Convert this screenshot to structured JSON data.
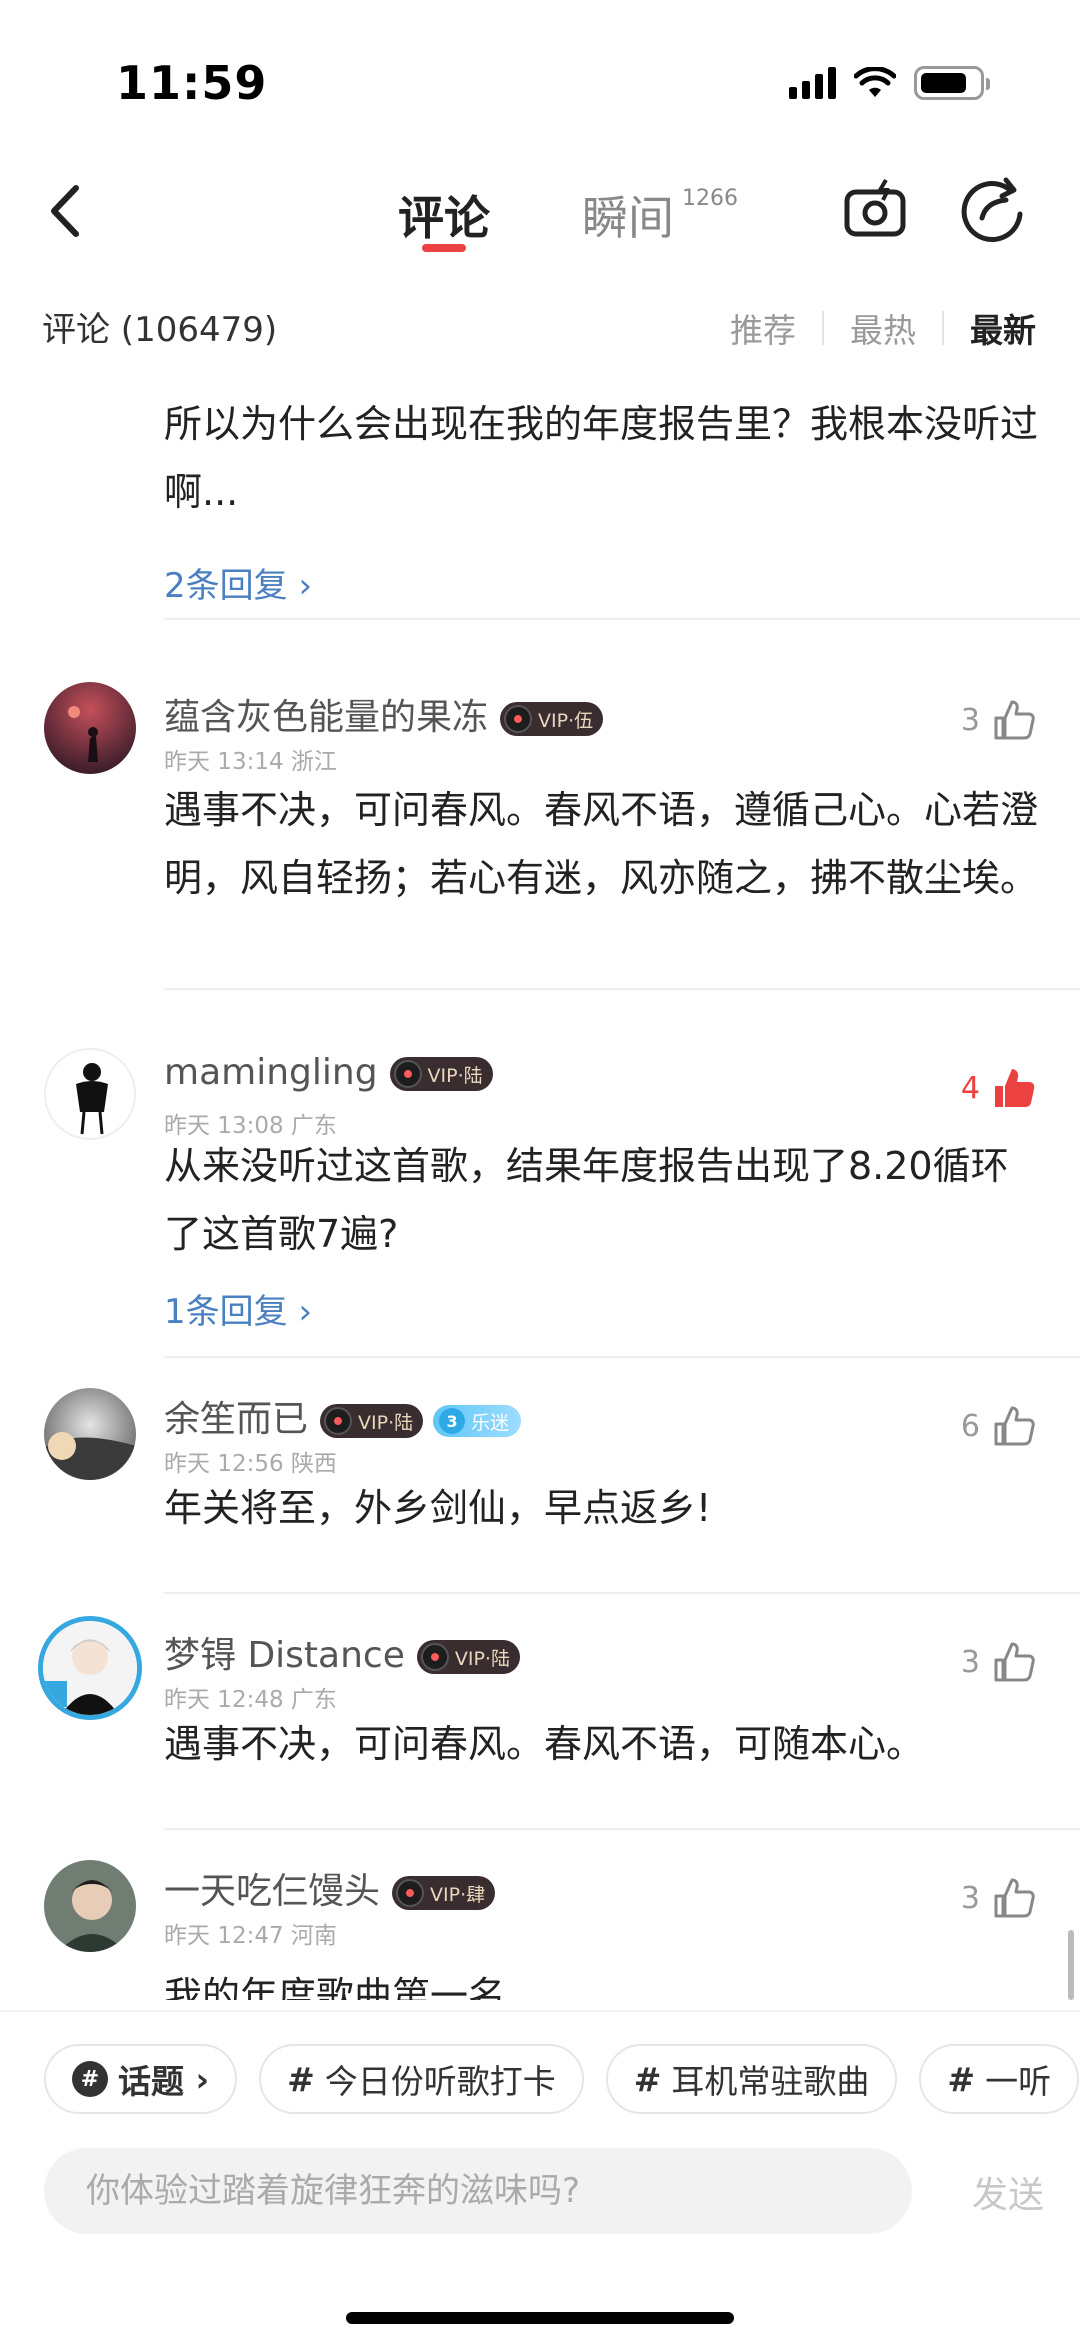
{
  "status_bar": {
    "time": "11:59",
    "battery_level": 0.8
  },
  "header": {
    "tabs": [
      {
        "label": "评论",
        "active": true
      },
      {
        "label": "瞬间",
        "count": "1266",
        "active": false
      }
    ],
    "icons": [
      "back-icon",
      "camera-icon",
      "share-icon"
    ],
    "accent_color": "#ec4141"
  },
  "subheader": {
    "comment_count_label": "评论 (106479)",
    "sort_options": [
      "推荐",
      "最热",
      "最新"
    ],
    "active_sort": "最新"
  },
  "comments": [
    {
      "body": "所以为什么会出现在我的年度报告里？我根本没听过啊...",
      "reply_label": "2条回复"
    },
    {
      "username": "蕴含灰色能量的果冻",
      "vip_label": "VIP·伍",
      "meta": "昨天 13:14  浙江",
      "likes": "3",
      "liked": false,
      "body": "遇事不决，可问春风。春风不语，遵循己心。心若澄明，风自轻扬；若心有迷，风亦随之，拂不散尘埃。"
    },
    {
      "username": "mamingling",
      "vip_label": "VIP·陆",
      "meta": "昨天 13:08  广东",
      "likes": "4",
      "liked": true,
      "body": "从来没听过这首歌，结果年度报告出现了8.20循环了这首歌7遍?",
      "reply_label": "1条回复"
    },
    {
      "username": "余笙而已",
      "vip_label": "VIP·陆",
      "fan_level": "3",
      "fan_label": "乐迷",
      "meta": "昨天 12:56  陕西",
      "likes": "6",
      "liked": false,
      "body": "年关将至，外乡剑仙，早点返乡!"
    },
    {
      "username": "梦锝 Distance",
      "vip_label": "VIP·陆",
      "meta": "昨天 12:48  广东",
      "likes": "3",
      "liked": false,
      "body": "遇事不决，可问春风。春风不语，可随本心。"
    },
    {
      "username": "一天吃仨馒头",
      "vip_label": "VIP·肆",
      "meta": "昨天 12:47  河南",
      "likes": "3",
      "liked": false,
      "body": "我的年度歌曲第一名"
    }
  ],
  "topics": [
    {
      "label": "话题"
    },
    {
      "label": "今日份听歌打卡"
    },
    {
      "label": "耳机常驻歌曲"
    },
    {
      "label": "一听"
    }
  ],
  "composer": {
    "placeholder": "你体验过踏着旋律狂奔的滋味吗?",
    "send_label": "发送"
  }
}
